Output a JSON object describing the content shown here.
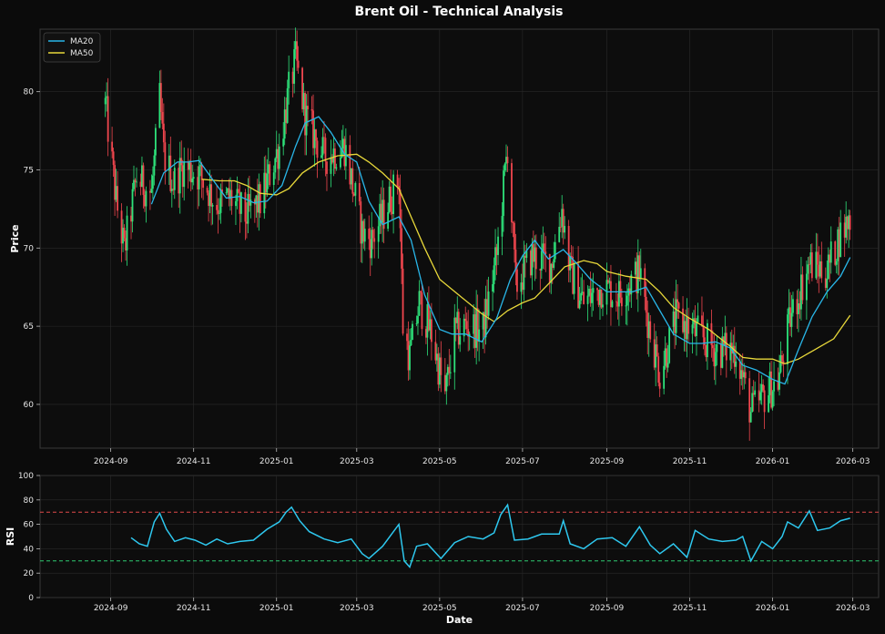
{
  "title": "Brent Oil - Technical Analysis",
  "colors": {
    "background": "#0b0b0b",
    "panel": "#0d0d0d",
    "grid": "#2a2a2a",
    "text": "#e6e6e6",
    "candle_up": "#2ee27a",
    "candle_down": "#f0464e",
    "ma20": "#29b6e8",
    "ma50": "#e8d83a",
    "rsi_line": "#2ec8ef",
    "rsi_overbought": "#e04a4a",
    "rsi_oversold": "#2ecc71"
  },
  "chart_data": [
    {
      "type": "line",
      "panel": "price",
      "ylabel": "Price",
      "ylim": [
        57.2,
        84.0
      ],
      "yticks": [
        60,
        65,
        70,
        75,
        80
      ],
      "x_tick_labels": [
        "2024-09",
        "2024-11",
        "2025-01",
        "2025-03",
        "2025-05",
        "2025-07",
        "2025-09",
        "2025-11",
        "2026-01",
        "2026-03"
      ],
      "grid": true,
      "legend_position": "top-left",
      "candles": "daily OHLC candlesticks; close path follows key points below",
      "close_keypoints": [
        [
          "2024-08-28",
          79.2
        ],
        [
          "2024-09-05",
          73.0
        ],
        [
          "2024-09-11",
          69.8
        ],
        [
          "2024-09-20",
          74.5
        ],
        [
          "2024-10-01",
          73.5
        ],
        [
          "2024-10-07",
          79.5
        ],
        [
          "2024-10-10",
          76.0
        ],
        [
          "2024-10-17",
          74.2
        ],
        [
          "2024-10-24",
          75.2
        ],
        [
          "2024-11-05",
          74.7
        ],
        [
          "2024-11-18",
          72.8
        ],
        [
          "2024-11-28",
          73.2
        ],
        [
          "2024-12-09",
          72.0
        ],
        [
          "2024-12-20",
          73.0
        ],
        [
          "2025-01-03",
          76.5
        ],
        [
          "2025-01-10",
          80.0
        ],
        [
          "2025-01-15",
          82.0
        ],
        [
          "2025-01-22",
          78.5
        ],
        [
          "2025-02-05",
          75.8
        ],
        [
          "2025-02-20",
          76.5
        ],
        [
          "2025-03-05",
          71.0
        ],
        [
          "2025-03-12",
          70.5
        ],
        [
          "2025-03-20",
          72.0
        ],
        [
          "2025-04-01",
          74.5
        ],
        [
          "2025-04-04",
          65.0
        ],
        [
          "2025-04-09",
          63.0
        ],
        [
          "2025-04-16",
          66.5
        ],
        [
          "2025-04-25",
          64.5
        ],
        [
          "2025-05-05",
          60.5
        ],
        [
          "2025-05-12",
          64.5
        ],
        [
          "2025-05-20",
          65.0
        ],
        [
          "2025-06-02",
          64.8
        ],
        [
          "2025-06-12",
          69.5
        ],
        [
          "2025-06-20",
          76.5
        ],
        [
          "2025-06-26",
          67.5
        ],
        [
          "2025-07-08",
          69.5
        ],
        [
          "2025-07-22",
          69.0
        ],
        [
          "2025-07-30",
          72.5
        ],
        [
          "2025-08-05",
          68.5
        ],
        [
          "2025-08-15",
          66.5
        ],
        [
          "2025-08-28",
          67.5
        ],
        [
          "2025-09-10",
          67.0
        ],
        [
          "2025-09-25",
          68.5
        ],
        [
          "2025-10-01",
          65.5
        ],
        [
          "2025-10-10",
          62.0
        ],
        [
          "2025-10-22",
          65.5
        ],
        [
          "2025-11-03",
          64.8
        ],
        [
          "2025-11-20",
          63.5
        ],
        [
          "2025-12-05",
          63.5
        ],
        [
          "2025-12-16",
          59.5
        ],
        [
          "2025-12-30",
          61.0
        ],
        [
          "2026-01-05",
          61.5
        ],
        [
          "2026-01-14",
          65.5
        ],
        [
          "2026-01-28",
          69.0
        ],
        [
          "2026-02-10",
          68.5
        ],
        [
          "2026-02-18",
          70.5
        ],
        [
          "2026-02-27",
          72.0
        ]
      ],
      "series": [
        {
          "name": "MA20",
          "points": [
            [
              "2024-10-01",
              72.8
            ],
            [
              "2024-10-10",
              74.8
            ],
            [
              "2024-10-20",
              75.5
            ],
            [
              "2024-10-28",
              75.5
            ],
            [
              "2024-11-05",
              75.6
            ],
            [
              "2024-11-14",
              74.5
            ],
            [
              "2024-11-25",
              73.2
            ],
            [
              "2024-12-05",
              73.3
            ],
            [
              "2024-12-15",
              72.9
            ],
            [
              "2024-12-25",
              73.0
            ],
            [
              "2025-01-05",
              74.0
            ],
            [
              "2025-01-15",
              76.5
            ],
            [
              "2025-01-22",
              78.0
            ],
            [
              "2025-02-01",
              78.4
            ],
            [
              "2025-02-10",
              77.4
            ],
            [
              "2025-02-20",
              76.0
            ],
            [
              "2025-03-01",
              75.5
            ],
            [
              "2025-03-10",
              73.0
            ],
            [
              "2025-03-20",
              71.5
            ],
            [
              "2025-04-01",
              72.0
            ],
            [
              "2025-04-10",
              70.5
            ],
            [
              "2025-04-20",
              67.0
            ],
            [
              "2025-05-01",
              64.8
            ],
            [
              "2025-05-10",
              64.5
            ],
            [
              "2025-05-20",
              64.5
            ],
            [
              "2025-06-01",
              64.0
            ],
            [
              "2025-06-12",
              65.5
            ],
            [
              "2025-06-22",
              68.0
            ],
            [
              "2025-07-01",
              69.5
            ],
            [
              "2025-07-10",
              70.5
            ],
            [
              "2025-07-20",
              69.3
            ],
            [
              "2025-07-31",
              69.9
            ],
            [
              "2025-08-10",
              69.0
            ],
            [
              "2025-08-20",
              68.0
            ],
            [
              "2025-09-01",
              67.2
            ],
            [
              "2025-09-10",
              67.2
            ],
            [
              "2025-09-20",
              67.2
            ],
            [
              "2025-09-30",
              67.5
            ],
            [
              "2025-10-10",
              66.0
            ],
            [
              "2025-10-20",
              64.5
            ],
            [
              "2025-11-01",
              63.9
            ],
            [
              "2025-11-10",
              63.9
            ],
            [
              "2025-11-20",
              64.0
            ],
            [
              "2025-12-01",
              63.6
            ],
            [
              "2025-12-10",
              62.5
            ],
            [
              "2025-12-20",
              62.2
            ],
            [
              "2026-01-01",
              61.6
            ],
            [
              "2026-01-10",
              61.3
            ],
            [
              "2026-01-20",
              63.5
            ],
            [
              "2026-01-30",
              65.6
            ],
            [
              "2026-02-10",
              67.2
            ],
            [
              "2026-02-20",
              68.2
            ],
            [
              "2026-02-27",
              69.4
            ]
          ]
        },
        {
          "name": "MA50",
          "points": [
            [
              "2024-11-07",
              74.4
            ],
            [
              "2024-11-20",
              74.3
            ],
            [
              "2024-12-01",
              74.3
            ],
            [
              "2024-12-10",
              74.0
            ],
            [
              "2024-12-20",
              73.5
            ],
            [
              "2025-01-01",
              73.4
            ],
            [
              "2025-01-10",
              73.8
            ],
            [
              "2025-01-20",
              74.8
            ],
            [
              "2025-02-01",
              75.5
            ],
            [
              "2025-02-15",
              75.9
            ],
            [
              "2025-03-01",
              76.0
            ],
            [
              "2025-03-10",
              75.5
            ],
            [
              "2025-03-20",
              74.8
            ],
            [
              "2025-04-01",
              73.8
            ],
            [
              "2025-04-10",
              72.0
            ],
            [
              "2025-04-20",
              70.0
            ],
            [
              "2025-05-01",
              68.0
            ],
            [
              "2025-05-15",
              67.0
            ],
            [
              "2025-06-01",
              65.8
            ],
            [
              "2025-06-10",
              65.3
            ],
            [
              "2025-06-20",
              66.0
            ],
            [
              "2025-07-01",
              66.5
            ],
            [
              "2025-07-10",
              66.8
            ],
            [
              "2025-07-20",
              67.7
            ],
            [
              "2025-08-01",
              68.8
            ],
            [
              "2025-08-15",
              69.2
            ],
            [
              "2025-08-25",
              69.0
            ],
            [
              "2025-09-01",
              68.5
            ],
            [
              "2025-09-15",
              68.2
            ],
            [
              "2025-09-30",
              68.0
            ],
            [
              "2025-10-10",
              67.2
            ],
            [
              "2025-10-20",
              66.2
            ],
            [
              "2025-11-01",
              65.5
            ],
            [
              "2025-11-15",
              64.8
            ],
            [
              "2025-12-01",
              63.7
            ],
            [
              "2025-12-10",
              63.0
            ],
            [
              "2025-12-20",
              62.9
            ],
            [
              "2026-01-01",
              62.9
            ],
            [
              "2026-01-10",
              62.6
            ],
            [
              "2026-01-20",
              62.9
            ],
            [
              "2026-02-01",
              63.5
            ],
            [
              "2026-02-15",
              64.2
            ],
            [
              "2026-02-27",
              65.7
            ]
          ]
        }
      ]
    },
    {
      "type": "line",
      "panel": "rsi",
      "xlabel": "Date",
      "ylabel": "RSI",
      "ylim": [
        0,
        100
      ],
      "yticks": [
        0,
        20,
        40,
        60,
        80,
        100
      ],
      "x_tick_labels": [
        "2024-09",
        "2024-11",
        "2025-01",
        "2025-03",
        "2025-05",
        "2025-07",
        "2025-09",
        "2025-11",
        "2026-01",
        "2026-03"
      ],
      "reference_lines": [
        70,
        30
      ],
      "grid": true,
      "series": [
        {
          "name": "RSI",
          "points": [
            [
              "2024-09-16",
              49
            ],
            [
              "2024-09-22",
              44
            ],
            [
              "2024-09-28",
              42
            ],
            [
              "2024-10-03",
              62
            ],
            [
              "2024-10-07",
              69
            ],
            [
              "2024-10-12",
              56
            ],
            [
              "2024-10-18",
              46
            ],
            [
              "2024-10-26",
              49
            ],
            [
              "2024-11-02",
              47
            ],
            [
              "2024-11-10",
              43
            ],
            [
              "2024-11-18",
              48
            ],
            [
              "2024-11-26",
              44
            ],
            [
              "2024-12-05",
              46
            ],
            [
              "2024-12-15",
              47
            ],
            [
              "2024-12-25",
              56
            ],
            [
              "2025-01-03",
              62
            ],
            [
              "2025-01-08",
              70
            ],
            [
              "2025-01-12",
              74
            ],
            [
              "2025-01-18",
              63
            ],
            [
              "2025-01-25",
              54
            ],
            [
              "2025-02-05",
              48
            ],
            [
              "2025-02-15",
              45
            ],
            [
              "2025-02-25",
              48
            ],
            [
              "2025-03-05",
              36
            ],
            [
              "2025-03-10",
              32
            ],
            [
              "2025-03-20",
              42
            ],
            [
              "2025-04-01",
              60
            ],
            [
              "2025-04-05",
              30
            ],
            [
              "2025-04-09",
              25
            ],
            [
              "2025-04-14",
              42
            ],
            [
              "2025-04-22",
              44
            ],
            [
              "2025-05-02",
              32
            ],
            [
              "2025-05-12",
              45
            ],
            [
              "2025-05-22",
              50
            ],
            [
              "2025-06-02",
              48
            ],
            [
              "2025-06-10",
              53
            ],
            [
              "2025-06-15",
              68
            ],
            [
              "2025-06-20",
              76
            ],
            [
              "2025-06-25",
              47
            ],
            [
              "2025-07-05",
              48
            ],
            [
              "2025-07-15",
              52
            ],
            [
              "2025-07-28",
              52
            ],
            [
              "2025-07-31",
              63
            ],
            [
              "2025-08-05",
              44
            ],
            [
              "2025-08-15",
              40
            ],
            [
              "2025-08-25",
              48
            ],
            [
              "2025-09-05",
              49
            ],
            [
              "2025-09-15",
              42
            ],
            [
              "2025-09-25",
              58
            ],
            [
              "2025-10-03",
              43
            ],
            [
              "2025-10-10",
              36
            ],
            [
              "2025-10-20",
              44
            ],
            [
              "2025-10-30",
              33
            ],
            [
              "2025-11-05",
              55
            ],
            [
              "2025-11-15",
              48
            ],
            [
              "2025-11-25",
              46
            ],
            [
              "2025-12-05",
              47
            ],
            [
              "2025-12-10",
              50
            ],
            [
              "2025-12-16",
              30
            ],
            [
              "2025-12-24",
              46
            ],
            [
              "2026-01-01",
              40
            ],
            [
              "2026-01-08",
              50
            ],
            [
              "2026-01-12",
              62
            ],
            [
              "2026-01-20",
              57
            ],
            [
              "2026-01-28",
              71
            ],
            [
              "2026-02-03",
              55
            ],
            [
              "2026-02-12",
              57
            ],
            [
              "2026-02-20",
              63
            ],
            [
              "2026-02-27",
              65
            ]
          ]
        }
      ]
    }
  ]
}
